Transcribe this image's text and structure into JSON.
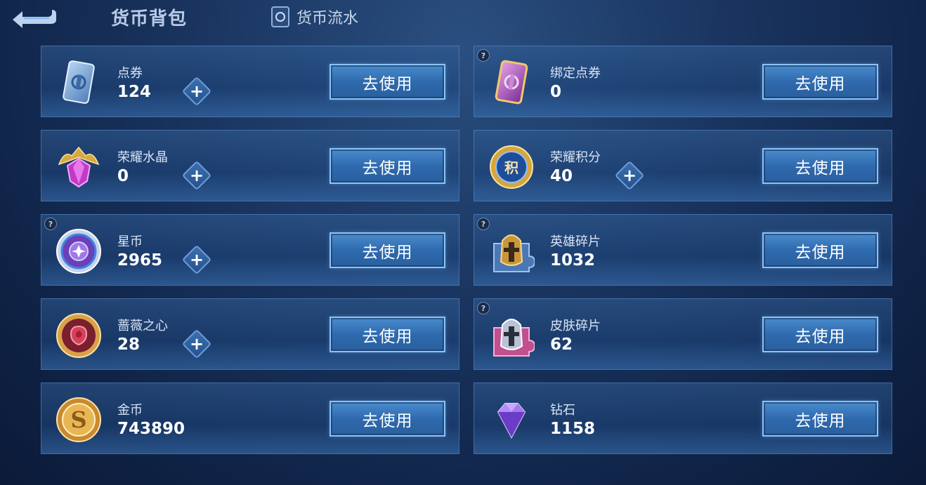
{
  "header": {
    "title": "货币背包",
    "ledger_tab": "货币流水"
  },
  "button_label": "去使用",
  "currencies": [
    {
      "name": "点券",
      "amount": "124",
      "icon": "coupon-card-icon",
      "has_plus": true,
      "has_help": false
    },
    {
      "name": "绑定点券",
      "amount": "0",
      "icon": "bound-coupon-card-icon",
      "has_plus": false,
      "has_help": true
    },
    {
      "name": "荣耀水晶",
      "amount": "0",
      "icon": "glory-crystal-icon",
      "has_plus": true,
      "has_help": false
    },
    {
      "name": "荣耀积分",
      "amount": "40",
      "icon": "glory-points-icon",
      "has_plus": true,
      "has_help": false
    },
    {
      "name": "星币",
      "amount": "2965",
      "icon": "star-coin-icon",
      "has_plus": true,
      "has_help": true
    },
    {
      "name": "英雄碎片",
      "amount": "1032",
      "icon": "hero-fragment-icon",
      "has_plus": false,
      "has_help": true
    },
    {
      "name": "蔷薇之心",
      "amount": "28",
      "icon": "rose-heart-icon",
      "has_plus": true,
      "has_help": false
    },
    {
      "name": "皮肤碎片",
      "amount": "62",
      "icon": "skin-fragment-icon",
      "has_plus": false,
      "has_help": true
    },
    {
      "name": "金币",
      "amount": "743890",
      "icon": "gold-coin-icon",
      "has_plus": false,
      "has_help": false
    },
    {
      "name": "钻石",
      "amount": "1158",
      "icon": "diamond-icon",
      "has_plus": false,
      "has_help": false
    }
  ],
  "colors": {
    "background": "#1a3560",
    "button": "#3a7abf",
    "button_border": "#8cc4f4"
  }
}
